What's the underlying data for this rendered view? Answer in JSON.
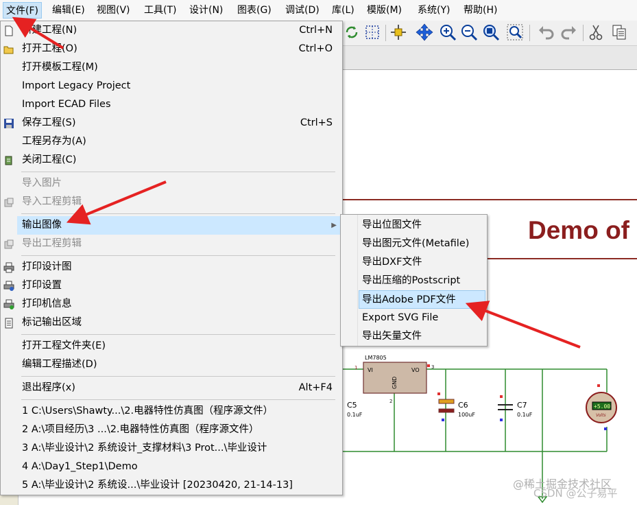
{
  "menubar": {
    "items": [
      {
        "label": "文件(F)"
      },
      {
        "label": "编辑(E)"
      },
      {
        "label": "视图(V)"
      },
      {
        "label": "工具(T)"
      },
      {
        "label": "设计(N)"
      },
      {
        "label": "图表(G)"
      },
      {
        "label": "调试(D)"
      },
      {
        "label": "库(L)"
      },
      {
        "label": "模版(M)"
      },
      {
        "label": "系统(Y)"
      },
      {
        "label": "帮助(H)"
      }
    ]
  },
  "file_menu": {
    "new_project": {
      "label": "新建工程(N)",
      "shortcut": "Ctrl+N"
    },
    "open_project": {
      "label": "打开工程(O)",
      "shortcut": "Ctrl+O"
    },
    "open_template": {
      "label": "打开模板工程(M)"
    },
    "import_legacy": {
      "label": "Import Legacy Project"
    },
    "import_ecad": {
      "label": "Import ECAD Files"
    },
    "save_project": {
      "label": "保存工程(S)",
      "shortcut": "Ctrl+S"
    },
    "save_as": {
      "label": "工程另存为(A)"
    },
    "close_project": {
      "label": "关闭工程(C)"
    },
    "import_image": {
      "label": "导入图片"
    },
    "import_clip": {
      "label": "导入工程剪辑"
    },
    "export_graphics": {
      "label": "输出图像"
    },
    "export_clip": {
      "label": "导出工程剪辑"
    },
    "print_design": {
      "label": "打印设计图"
    },
    "print_setup": {
      "label": "打印设置"
    },
    "printer_info": {
      "label": "打印机信息"
    },
    "mark_output": {
      "label": "标记输出区域"
    },
    "open_folder": {
      "label": "打开工程文件夹(E)"
    },
    "edit_description": {
      "label": "编辑工程描述(D)"
    },
    "exit": {
      "label": "退出程序(x)",
      "shortcut": "Alt+F4"
    },
    "recent": [
      "1 C:\\Users\\Shawty...\\2.电器特性仿真图（程序源文件）",
      "2 A:\\项目经历\\3 ...\\2.电器特性仿真图（程序源文件）",
      "3 A:\\毕业设计\\2 系统设计_支撑材料\\3 Prot...\\毕业设计",
      "4 A:\\Day1_Step1\\Demo",
      "5 A:\\毕业设计\\2 系统设...\\毕业设计 [20230420, 21-14-13]"
    ]
  },
  "export_submenu": {
    "items": [
      {
        "label": "导出位图文件"
      },
      {
        "label": "导出图元文件(Metafile)"
      },
      {
        "label": "导出DXF文件"
      },
      {
        "label": "导出压缩的Postscript"
      },
      {
        "label": "导出Adobe PDF文件"
      },
      {
        "label": "Export SVG File"
      },
      {
        "label": "导出矢量文件"
      }
    ]
  },
  "schematic": {
    "title": "Demo of",
    "regulator_name": "LM7805",
    "reg_pin_vi": "VI",
    "reg_pin_vo": "VO",
    "reg_pin_gnd": "GND",
    "pin1": "1",
    "pin2": "2",
    "pin3": "3",
    "c5_name": "C5",
    "c5_value": "0.1uF",
    "c6_name": "C6",
    "c6_value": "100uF",
    "c7_name": "C7",
    "c7_value": "0.1uF",
    "voltmeter_reading": "+5.00",
    "voltmeter_unit": "Volts",
    "wire_color": "#2e8b2e",
    "title_color": "#8b1e1e"
  },
  "watermark": {
    "line1": "@稀土掘金技术社区",
    "line2": "CSDN @公子易平"
  }
}
